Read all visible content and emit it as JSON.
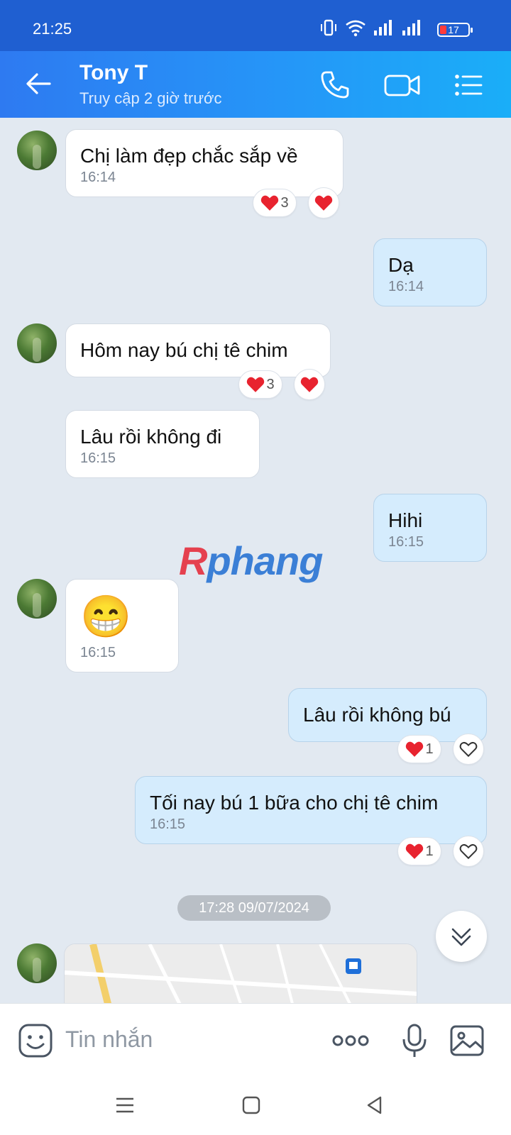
{
  "status_bar": {
    "time": "21:25",
    "battery": "17"
  },
  "header": {
    "contact_name": "Tony T",
    "last_seen": "Truy cập 2 giờ trước"
  },
  "messages": [
    {
      "dir": "in",
      "text": "Chị làm đẹp chắc sắp về",
      "time": "16:14",
      "reaction_count": "3"
    },
    {
      "dir": "out",
      "text": "Dạ",
      "time": "16:14"
    },
    {
      "dir": "in",
      "text": "Hôm nay bú chị tê chim",
      "reaction_count": "3"
    },
    {
      "dir": "in",
      "text": "Lâu rồi không đi",
      "time": "16:15"
    },
    {
      "dir": "out",
      "text": "Hihi",
      "time": "16:15"
    },
    {
      "dir": "in",
      "emoji": "😁",
      "time": "16:15"
    },
    {
      "dir": "out",
      "text": "Lâu rồi không bú",
      "reaction_count": "1"
    },
    {
      "dir": "out",
      "text": "Tối nay bú 1 bữa cho chị tê chim",
      "time": "16:15",
      "reaction_count": "1"
    }
  ],
  "date_separator": "17:28 09/07/2024",
  "watermark": {
    "part1": "R",
    "part2": "phang"
  },
  "input": {
    "placeholder": "Tin nhắn"
  },
  "colors": {
    "header": "#2596f8",
    "incoming": "#ffffff",
    "outgoing": "#d5ecfd",
    "heart": "#e8232f"
  }
}
